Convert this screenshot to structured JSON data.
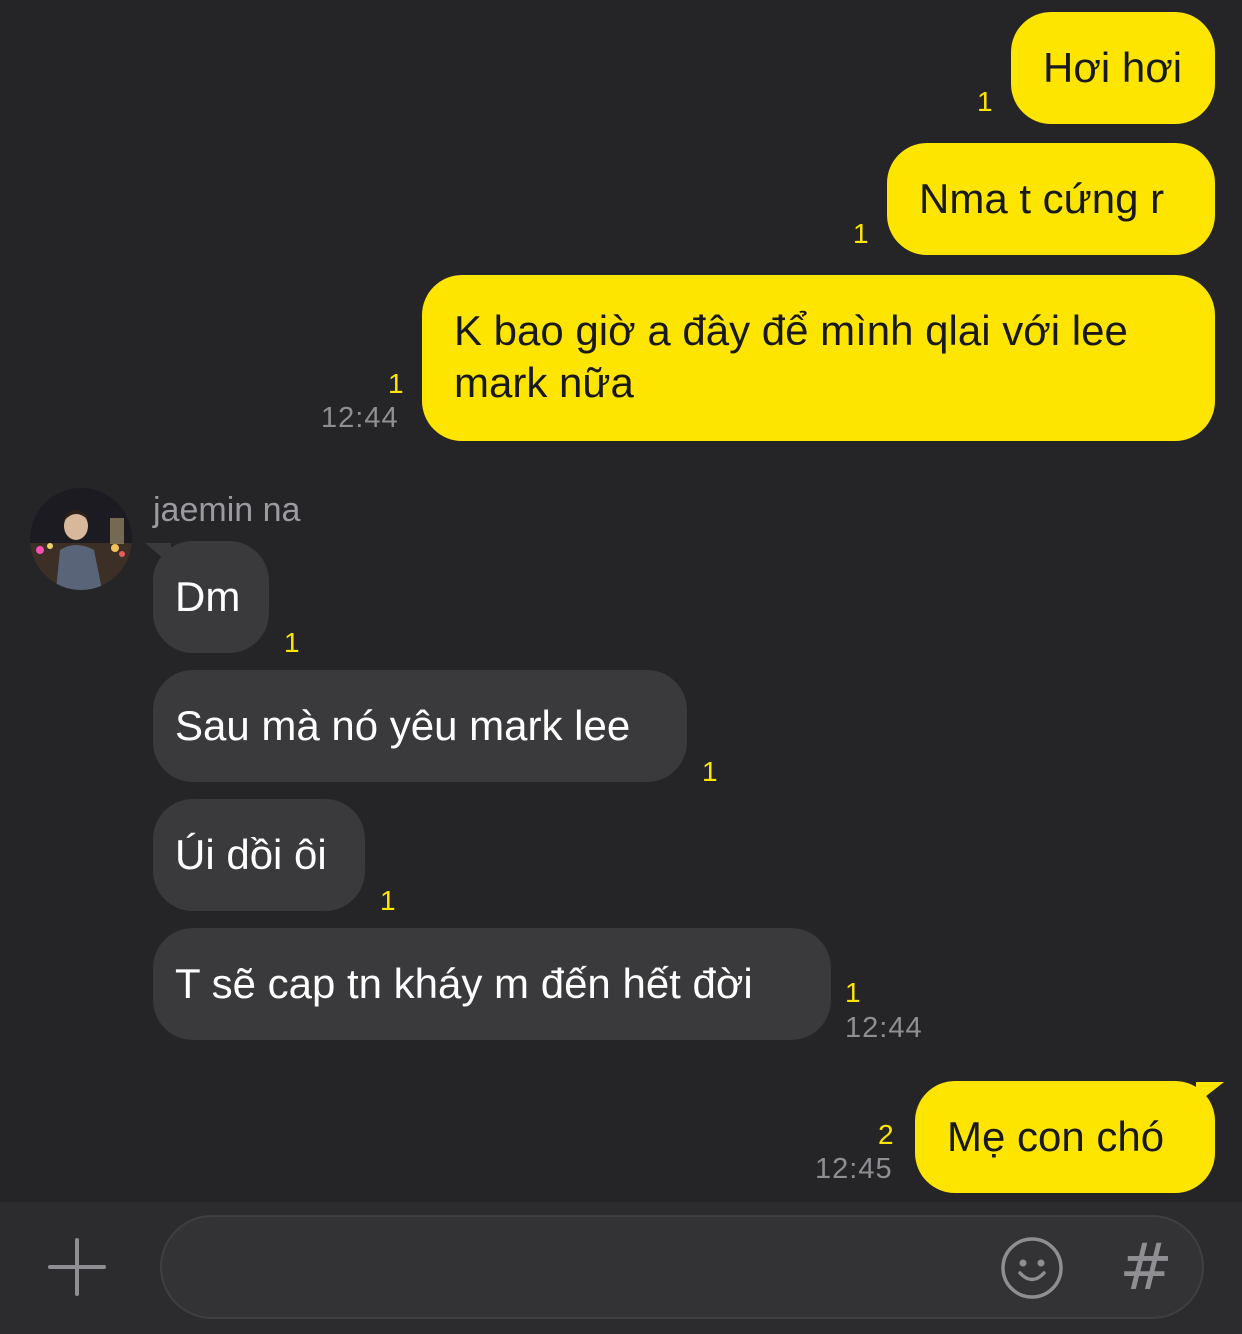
{
  "colors": {
    "background": "#252527",
    "outgoing_bubble": "#fee500",
    "incoming_bubble": "#3a3a3c",
    "unread_count": "#fee500",
    "timestamp": "#8e8e93"
  },
  "messages_out_top": [
    {
      "text": "Hơi hơi",
      "unread": "1"
    },
    {
      "text": "Nma t cứng r",
      "unread": "1"
    },
    {
      "text": "K bao giờ a đây để mình qlai với lee mark nữa",
      "unread": "1",
      "time": "12:44"
    }
  ],
  "contact": {
    "name": "jaemin na",
    "avatar_icon": "profile-photo-icon"
  },
  "messages_in": [
    {
      "text": "Dm",
      "unread": "1"
    },
    {
      "text": "Sau mà nó yêu mark lee",
      "unread": "1"
    },
    {
      "text": "Úi dồi ôi",
      "unread": "1"
    },
    {
      "text": "T sẽ cap tn kháy m đến hết đời",
      "unread": "1",
      "time": "12:44"
    }
  ],
  "messages_out_bottom": [
    {
      "text": "Mẹ con chó",
      "unread": "2",
      "time": "12:45"
    }
  ],
  "composer": {
    "plus_icon": "plus-icon",
    "input_placeholder": "",
    "emoji_icon": "smiley-icon",
    "hash_label": "#"
  }
}
